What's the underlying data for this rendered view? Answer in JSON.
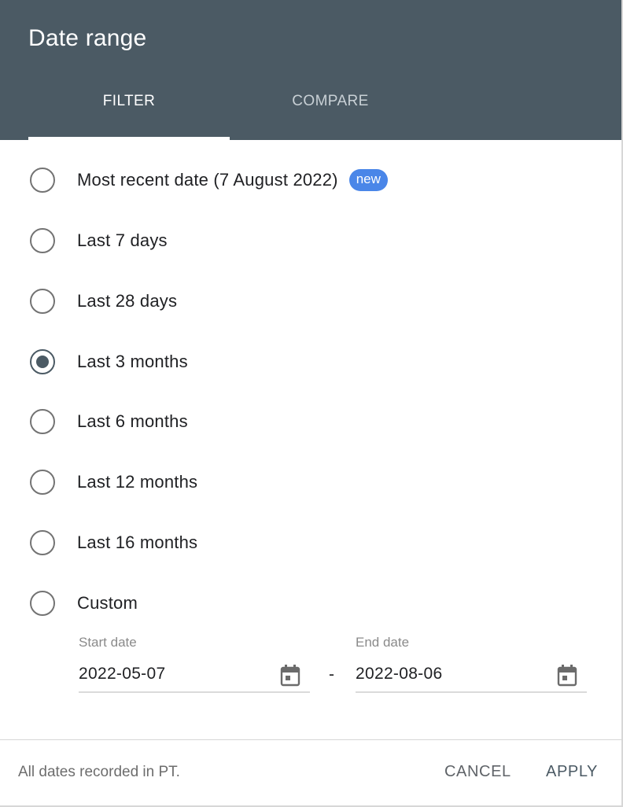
{
  "dialog": {
    "title": "Date range",
    "tabs": [
      {
        "label": "FILTER",
        "active": true
      },
      {
        "label": "COMPARE",
        "active": false
      }
    ]
  },
  "options": [
    {
      "label": "Most recent date (7 August 2022)",
      "badge": "new",
      "checked": false
    },
    {
      "label": "Last 7 days",
      "checked": false
    },
    {
      "label": "Last 28 days",
      "checked": false
    },
    {
      "label": "Last 3 months",
      "checked": true
    },
    {
      "label": "Last 6 months",
      "checked": false
    },
    {
      "label": "Last 12 months",
      "checked": false
    },
    {
      "label": "Last 16 months",
      "checked": false
    },
    {
      "label": "Custom",
      "checked": false
    }
  ],
  "custom": {
    "start_label": "Start date",
    "start_value": "2022-05-07",
    "separator": "-",
    "end_label": "End date",
    "end_value": "2022-08-06",
    "icon": "calendar-icon"
  },
  "footer": {
    "note": "All dates recorded in PT.",
    "cancel_label": "CANCEL",
    "apply_label": "APPLY"
  },
  "colors": {
    "header_bg": "#4b5a64",
    "badge_bg": "#4a86e8",
    "radio_checked": "#4b5a64"
  }
}
